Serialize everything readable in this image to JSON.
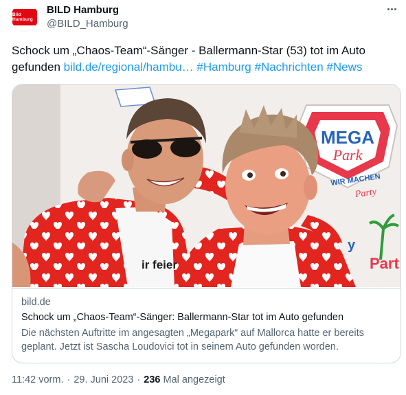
{
  "account": {
    "display_name": "BILD Hamburg",
    "handle": "@BILD_Hamburg",
    "avatar_text": "Bild Hamburg",
    "avatar_color": "#e30613"
  },
  "tweet": {
    "text_prefix": "Schock um „Chaos-Team“-Sänger - Ballermann-Star (53) tot im Auto gefunden ",
    "link": "bild.de/regional/hambu…",
    "hashtags": [
      "#Hamburg",
      "#Nachrichten",
      "#News"
    ],
    "link_color": "#1d9bf0"
  },
  "card": {
    "image_sign": {
      "line1": "MEGA",
      "line2": "Park",
      "line3": "WIR MACHEN",
      "line4": "Party",
      "side": "Part"
    },
    "shirt_text": "ir feier",
    "domain": "bild.de",
    "title": "Schock um „Chaos-Team“-Sänger: Ballermann-Star tot im Auto gefunden",
    "description": "Die nächsten Auftritte im angesagten „Megapark“ auf Mallorca hatte er bereits geplant. Jetzt ist Sascha Loudovici tot in seinem Auto gefunden worden."
  },
  "meta": {
    "time": "11:42 vorm.",
    "date": "29. Juni 2023",
    "views_count": "236",
    "views_label": "Mal angezeigt"
  },
  "icons": {
    "more": "more-horizontal-icon"
  }
}
